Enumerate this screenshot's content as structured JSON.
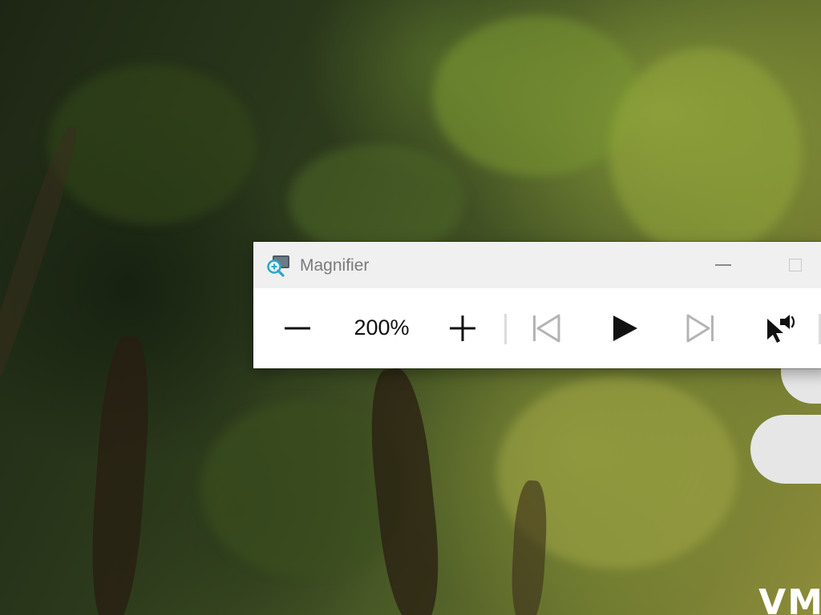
{
  "desktop": {
    "wallpaper": "forest-canopy",
    "corner_text": "VM"
  },
  "magnifier": {
    "title": "Magnifier",
    "app_icon": "magnifier-icon",
    "title_buttons": {
      "minimize": "minimize-icon",
      "maximize": "maximize-icon"
    },
    "toolbar": {
      "zoom_out_icon": "minus-icon",
      "zoom_level": "200%",
      "zoom_in_icon": "plus-icon",
      "previous_icon": "skip-previous-icon",
      "play_icon": "play-icon",
      "next_icon": "skip-next-icon",
      "read_from_here_icon": "pointer-speaker-icon"
    },
    "colors": {
      "titlebar": "#f0f0f0",
      "toolbar": "#ffffff",
      "icon_active": "#111111",
      "icon_disabled": "#b4b4b4",
      "accent": "#2aa7c9"
    }
  }
}
